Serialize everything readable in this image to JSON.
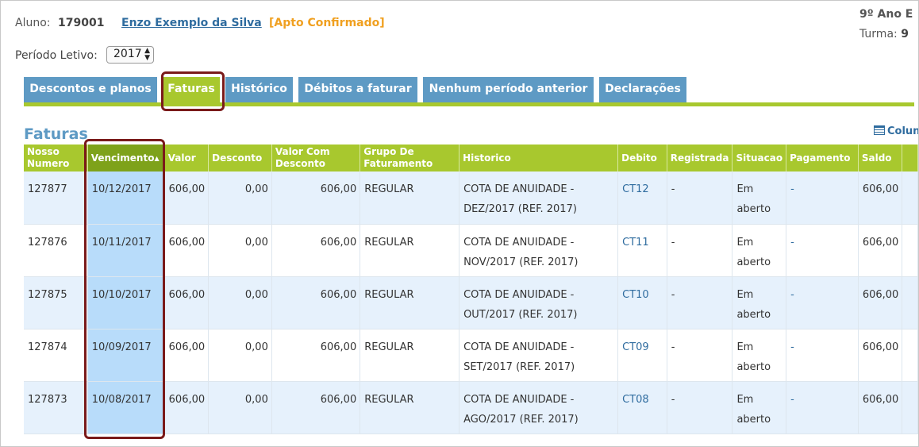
{
  "header": {
    "aluno_label": "Aluno:",
    "aluno_numero": "179001",
    "aluno_nome": "Enzo Exemplo da Silva",
    "aluno_status": "[Apto Confirmado]",
    "ano": "9º Ano E",
    "turma_label": "Turma:",
    "turma_valor": "9"
  },
  "periodo": {
    "label": "Período Letivo:",
    "selected": "2017"
  },
  "tabs": [
    {
      "label": "Descontos e planos",
      "active": false
    },
    {
      "label": "Faturas",
      "active": true
    },
    {
      "label": "Histórico",
      "active": false
    },
    {
      "label": "Débitos a faturar",
      "active": false
    },
    {
      "label": "Nenhum período anterior",
      "active": false
    },
    {
      "label": "Declarações",
      "active": false
    }
  ],
  "section": {
    "title": "Faturas",
    "colunas_label": "Colun"
  },
  "table": {
    "columns": [
      "Nosso Numero",
      "Vencimento",
      "Valor",
      "Desconto",
      "Valor Com Desconto",
      "Grupo De Faturamento",
      "Historico",
      "Debito",
      "Registrada",
      "Situacao",
      "Pagamento",
      "Saldo"
    ],
    "sort_indicator": "▲",
    "rows": [
      {
        "nosso_numero": "127877",
        "vencimento": "10/12/2017",
        "valor": "606,00",
        "desconto": "0,00",
        "valor_com_desconto": "606,00",
        "grupo": "REGULAR",
        "historico": "COTA DE ANUIDADE - DEZ/2017 (REF. 2017)",
        "debito": "CT12",
        "registrada": "-",
        "situacao": "Em aberto",
        "pagamento": "-",
        "saldo": "606,00"
      },
      {
        "nosso_numero": "127876",
        "vencimento": "10/11/2017",
        "valor": "606,00",
        "desconto": "0,00",
        "valor_com_desconto": "606,00",
        "grupo": "REGULAR",
        "historico": "COTA DE ANUIDADE - NOV/2017 (REF. 2017)",
        "debito": "CT11",
        "registrada": "-",
        "situacao": "Em aberto",
        "pagamento": "-",
        "saldo": "606,00"
      },
      {
        "nosso_numero": "127875",
        "vencimento": "10/10/2017",
        "valor": "606,00",
        "desconto": "0,00",
        "valor_com_desconto": "606,00",
        "grupo": "REGULAR",
        "historico": "COTA DE ANUIDADE - OUT/2017 (REF. 2017)",
        "debito": "CT10",
        "registrada": "-",
        "situacao": "Em aberto",
        "pagamento": "-",
        "saldo": "606,00"
      },
      {
        "nosso_numero": "127874",
        "vencimento": "10/09/2017",
        "valor": "606,00",
        "desconto": "0,00",
        "valor_com_desconto": "606,00",
        "grupo": "REGULAR",
        "historico": "COTA DE ANUIDADE - SET/2017 (REF. 2017)",
        "debito": "CT09",
        "registrada": "-",
        "situacao": "Em aberto",
        "pagamento": "-",
        "saldo": "606,00"
      },
      {
        "nosso_numero": "127873",
        "vencimento": "10/08/2017",
        "valor": "606,00",
        "desconto": "0,00",
        "valor_com_desconto": "606,00",
        "grupo": "REGULAR",
        "historico": "COTA DE ANUIDADE - AGO/2017 (REF. 2017)",
        "debito": "CT08",
        "registrada": "-",
        "situacao": "Em aberto",
        "pagamento": "-",
        "saldo": "606,00"
      }
    ]
  }
}
